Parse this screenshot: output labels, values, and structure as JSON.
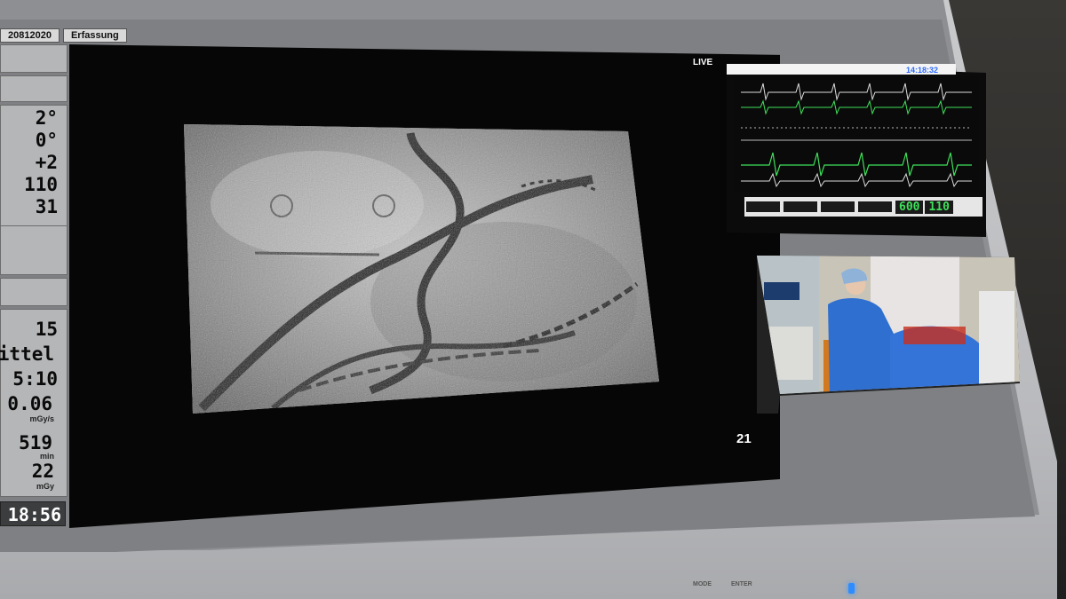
{
  "tabs": {
    "date_id": "20812020",
    "mode": "Erfassung"
  },
  "left_panel": {
    "angle_1": "2°",
    "angle_2": "0°",
    "offset": "+2",
    "kv": "110",
    "ma": "31",
    "frames": "15",
    "mode": "Mittel",
    "fluoro_time": "5:10",
    "dose_rate": "0.06",
    "dose_rate_unit": "mGy/s",
    "fluoro_minutes": "519",
    "fluoro_minutes_unit": "min",
    "dose": "22",
    "dose_unit": "mGy",
    "clock": "18:56"
  },
  "viewer": {
    "live_label": "LIVE",
    "frame_number": "21"
  },
  "ecg_monitor": {
    "clock": "14:18:32",
    "value_1": "600",
    "value_2": "110",
    "trace_color": "#3fe05a"
  },
  "monitor_buttons": [
    "MODE",
    "ENTER"
  ]
}
